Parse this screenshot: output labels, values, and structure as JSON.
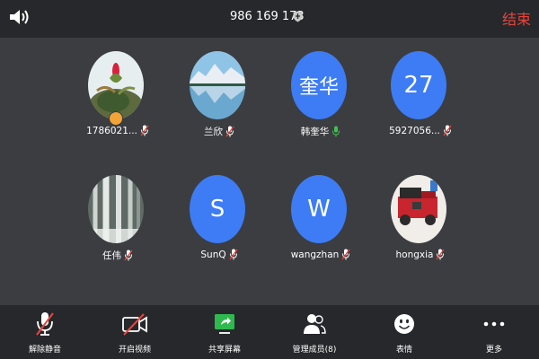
{
  "header": {
    "meeting_id": "986 169 173",
    "end_label": "结束"
  },
  "participants": [
    {
      "name": "1786021...",
      "avatar": "photo-flower",
      "mic": "muted",
      "host": true
    },
    {
      "name": "兰欣",
      "avatar": "photo-lake",
      "mic": "muted"
    },
    {
      "name": "韩奎华",
      "avatar_text": "奎华",
      "mic": "active"
    },
    {
      "name": "5927056...",
      "avatar_text": "27",
      "mic": "muted"
    },
    {
      "name": "任伟",
      "avatar": "photo-waterfall",
      "mic": "muted"
    },
    {
      "name": "SunQ",
      "avatar_text": "S",
      "mic": "muted"
    },
    {
      "name": "wangzhan",
      "avatar_text": "W",
      "mic": "muted"
    },
    {
      "name": "hongxia",
      "avatar": "photo-lego",
      "mic": "muted"
    }
  ],
  "toolbar": {
    "unmute_label": "解除静音",
    "video_label": "开启视频",
    "share_label": "共享屏幕",
    "participants_label": "管理成员(8)",
    "reactions_label": "表情",
    "more_label": "更多"
  },
  "colors": {
    "avatar_blue": "#3d7cf4",
    "end_red": "#e8453c",
    "mic_muted": "#e8453c",
    "mic_active": "#3fc14c",
    "share_green": "#2fb84e",
    "host_badge": "#f2a536"
  }
}
